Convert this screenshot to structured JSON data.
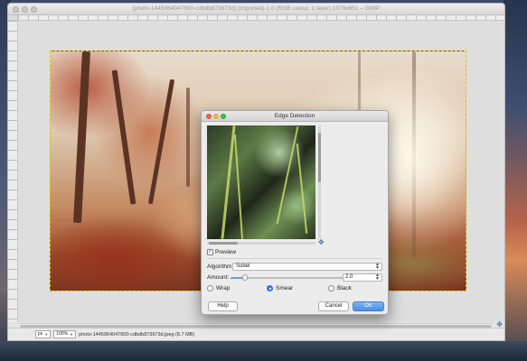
{
  "gimp": {
    "window_title": "[photo-1445964047600-cdbdb873673d] (imported)-1.0 (RGB colour, 1 layer) 1079x651 – GIMP",
    "statusbar": {
      "unit": "px",
      "zoom": "100%",
      "info": "photo-1445964047600-cdbdb873673d.jpeg (8.7 MB)"
    }
  },
  "dialog": {
    "title": "Edge Detection",
    "preview_label": "Preview",
    "preview_checked": true,
    "algorithm_label": "Algorithm:",
    "algorithm_value": "Sobel",
    "amount_label": "Amount:",
    "amount_value": "2.0",
    "amount_fraction": 0.13,
    "edge_options": [
      {
        "label": "Wrap",
        "selected": false
      },
      {
        "label": "Smear",
        "selected": true
      },
      {
        "label": "Black",
        "selected": false
      }
    ],
    "buttons": {
      "help": "Help",
      "cancel": "Cancel",
      "ok": "OK"
    }
  },
  "icons": {
    "navigate": "move-cross-icon"
  },
  "colors": {
    "accent": "#3d7ee6",
    "ok_button": "#4c8fe6",
    "selection_border": "#d6c400"
  }
}
